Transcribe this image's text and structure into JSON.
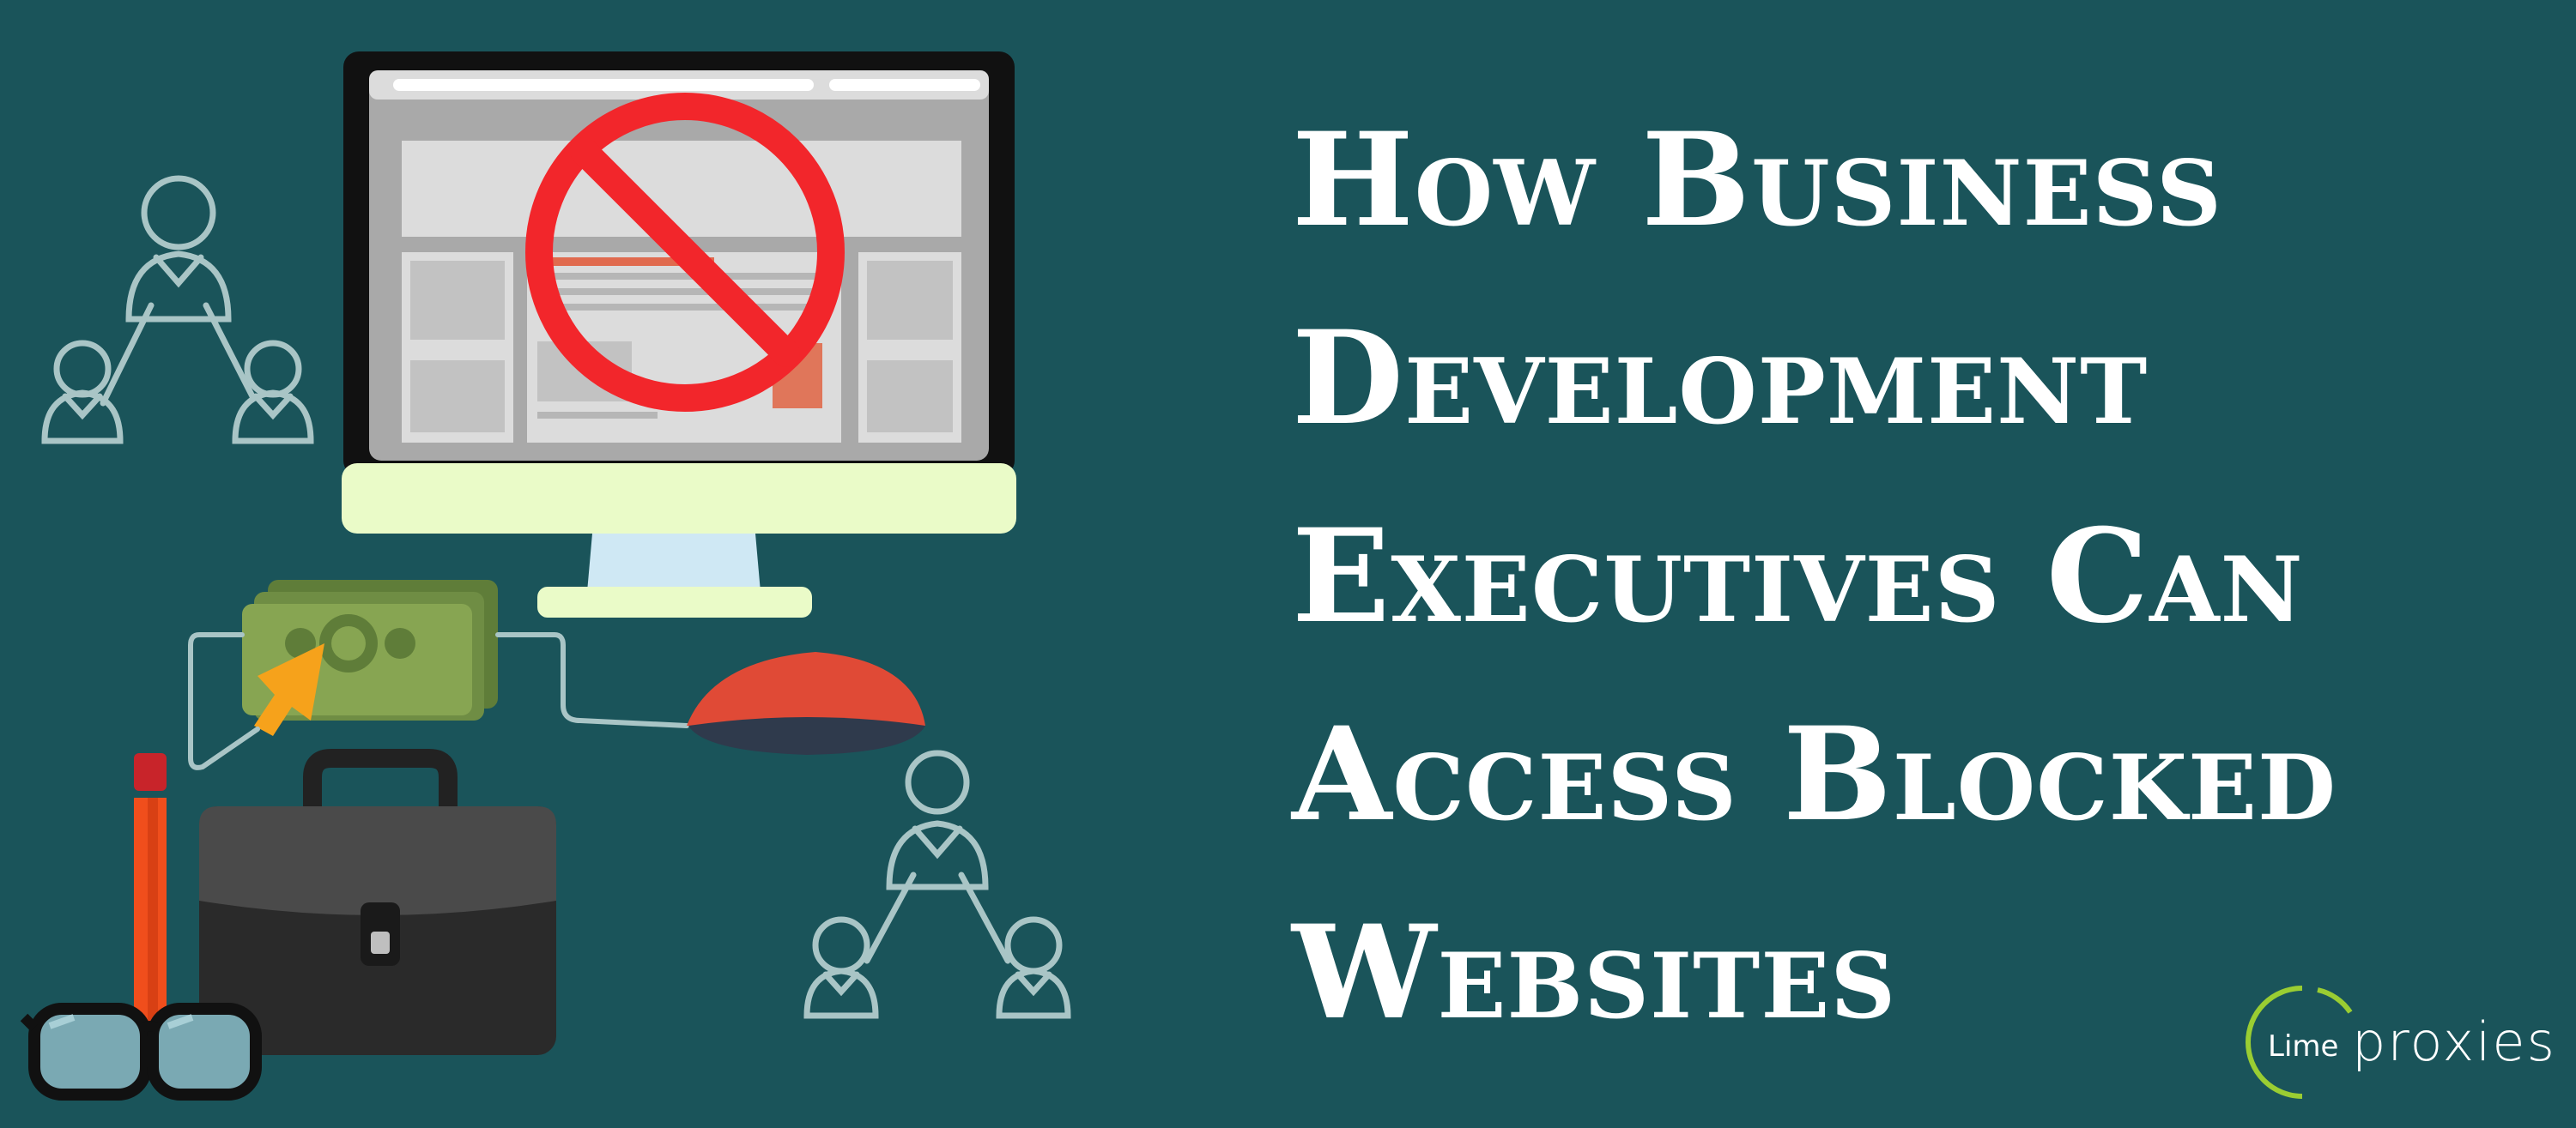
{
  "headline": {
    "lines": [
      "How Business",
      "Development",
      "Executives Can",
      "Access Blocked",
      "Websites"
    ]
  },
  "logo": {
    "small_text": "Lime",
    "big_text": "proxies",
    "accent_color": "#9acd32"
  },
  "colors": {
    "background": "#1a545a",
    "prohibition_sign": "#f2262b",
    "text": "#ffffff"
  },
  "icons": [
    "computer-monitor",
    "prohibition-sign",
    "people-network-icon",
    "money-bill-icon",
    "cursor-arrow-icon",
    "computer-mouse-icon",
    "briefcase-icon",
    "pencil-icon",
    "glasses-icon"
  ]
}
